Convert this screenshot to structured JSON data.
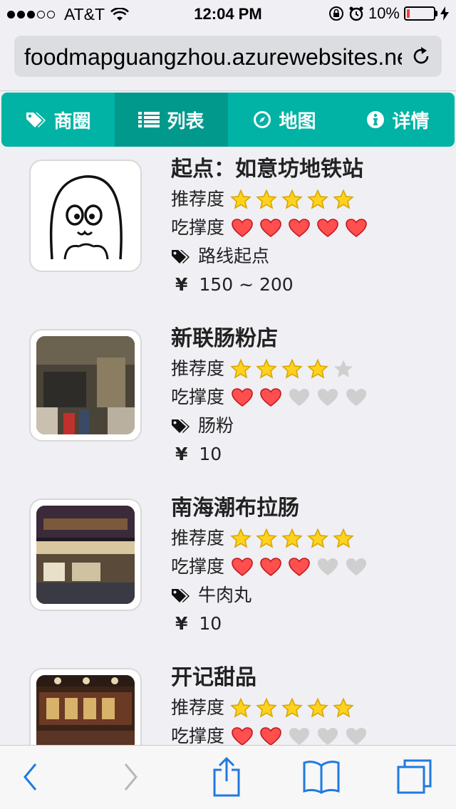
{
  "status_bar": {
    "carrier": "AT&T",
    "signal_full": 3,
    "signal_total": 5,
    "time": "12:04 PM",
    "battery_percent": "10%",
    "battery_level": 0.1
  },
  "browser": {
    "url": "foodmapguangzhou.azurewebsites.net"
  },
  "tabs": [
    {
      "label": "商圈",
      "icon": "tags-icon",
      "active": false
    },
    {
      "label": "列表",
      "icon": "list-icon",
      "active": true
    },
    {
      "label": "地图",
      "icon": "compass-icon",
      "active": false
    },
    {
      "label": "详情",
      "icon": "info-icon",
      "active": false
    }
  ],
  "labels": {
    "recommend": "推荐度",
    "filling": "吃撑度",
    "currency": "¥"
  },
  "colors": {
    "accent": "#00b3a4",
    "accent_active": "#00998c",
    "star_on": "#ffd21f",
    "heart_on": "#ff4f4f",
    "icon_off": "#cfcfcf"
  },
  "items": [
    {
      "name": "起点：如意坊地铁站",
      "recommend": 5,
      "filling": 5,
      "tag": "路线起点",
      "price": "150 ~ 200",
      "thumb": "cartoon-drawing"
    },
    {
      "name": "新联肠粉店",
      "recommend": 4,
      "filling": 2,
      "tag": "肠粉",
      "price": "10",
      "thumb": "street-shop-photo"
    },
    {
      "name": "南海潮布拉肠",
      "recommend": 5,
      "filling": 3,
      "tag": "牛肉丸",
      "price": "10",
      "thumb": "night-storefront-photo"
    },
    {
      "name": "开记甜品",
      "recommend": 5,
      "filling": 2,
      "tag": "",
      "price": "",
      "thumb": "signboard-photo"
    }
  ]
}
